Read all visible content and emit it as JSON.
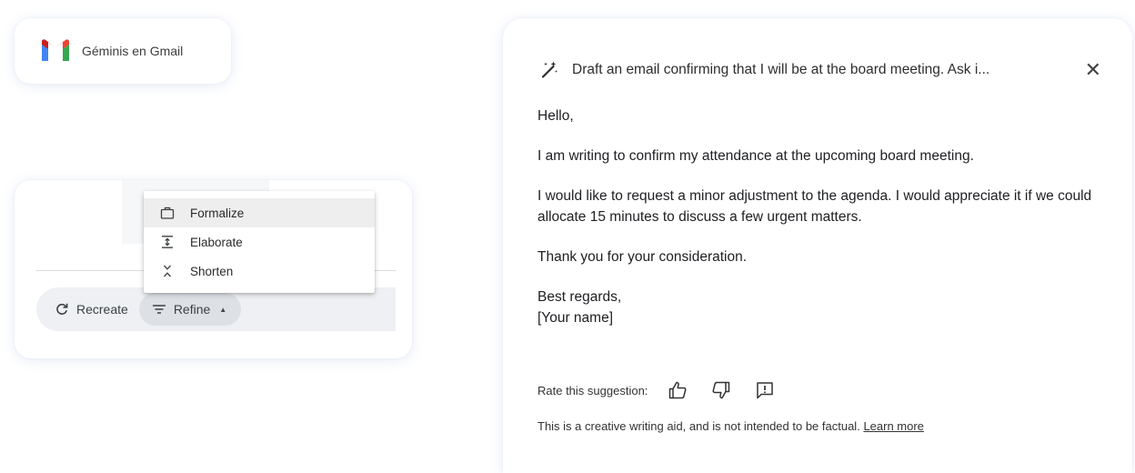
{
  "badge": {
    "title": "Géminis en Gmail",
    "icon": "gmail-logo"
  },
  "refine_panel": {
    "menu": [
      {
        "label": "Formalize",
        "icon": "briefcase-icon",
        "highlighted": true
      },
      {
        "label": "Elaborate",
        "icon": "expand-icon",
        "highlighted": false
      },
      {
        "label": "Shorten",
        "icon": "collapse-icon",
        "highlighted": false
      }
    ],
    "recreate_label": "Recreate",
    "refine_label": "Refine"
  },
  "draft": {
    "prompt": "Draft an email confirming that I will be at the board meeting. Ask i...",
    "close_glyph": "✕",
    "greeting": "Hello,",
    "paragraph1": "I am writing to confirm my attendance at the upcoming board meeting.",
    "paragraph2": "I would like to request a minor adjustment to the agenda. I would appreciate it if we could allocate 15 minutes to discuss a few urgent matters.",
    "paragraph3": "Thank you for your consideration.",
    "signoff": "Best regards,",
    "signature": "[Your name]",
    "rate_label": "Rate this suggestion:",
    "disclaimer": "This is a creative writing aid, and is not intended to be factual.",
    "learn_more": "Learn more"
  },
  "colors": {
    "gmail_red": "#EA4335",
    "gmail_blue": "#4285F4",
    "gmail_green": "#34A853",
    "gmail_yellow": "#FBBC04",
    "bar_bg": "#eef0f3",
    "menu_highlight": "#eeeeee"
  }
}
